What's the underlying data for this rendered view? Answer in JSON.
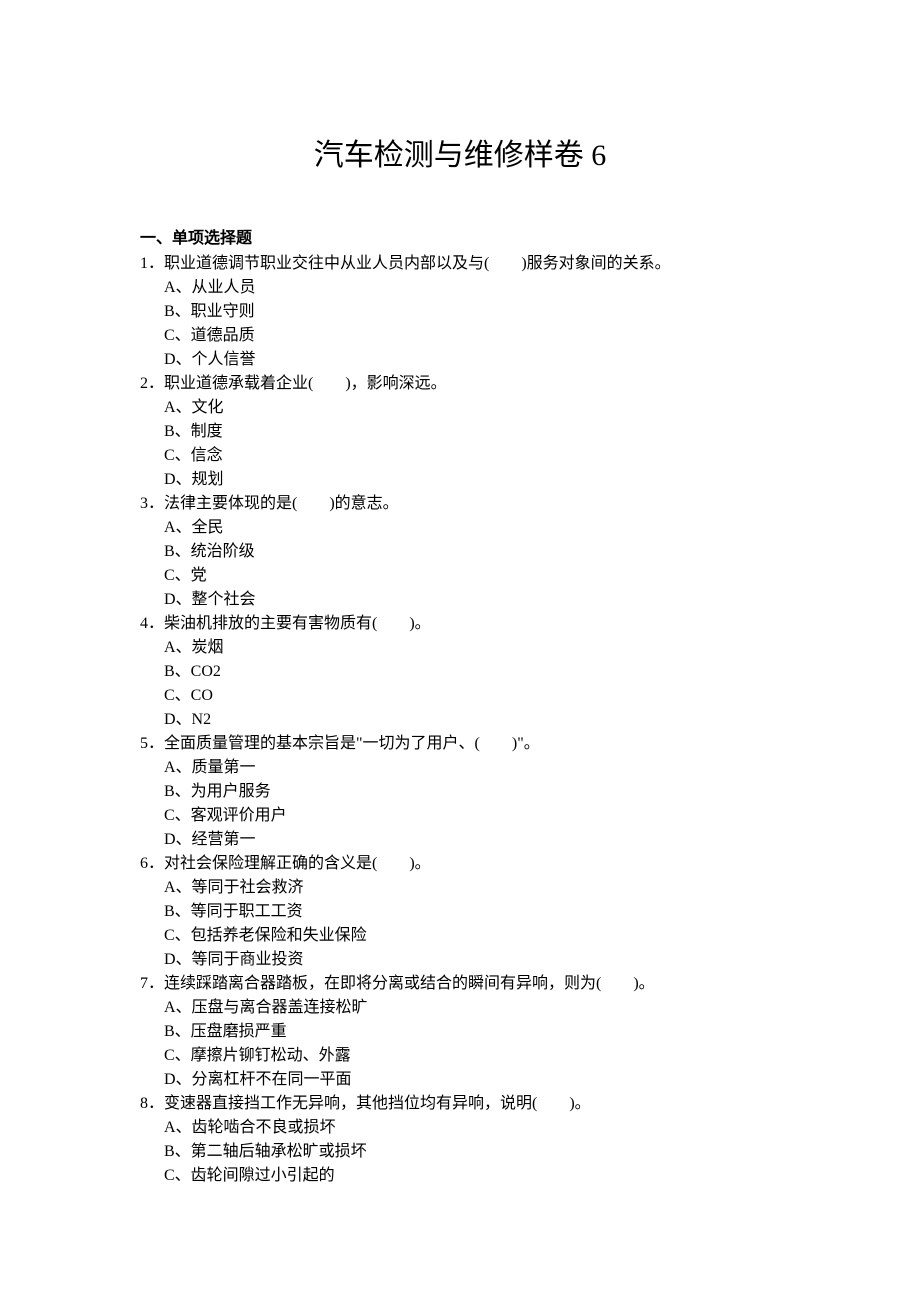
{
  "title": "汽车检测与维修样卷 6",
  "section_heading": "一、单项选择题",
  "questions": [
    {
      "num": "1．",
      "text": "职业道德调节职业交往中从业人员内部以及与(　　)服务对象间的关系。",
      "options": [
        "A、从业人员",
        "B、职业守则",
        "C、道德品质",
        "D、个人信誉"
      ]
    },
    {
      "num": "2．",
      "text": "职业道德承载着企业(　　)，影响深远。",
      "options": [
        "A、文化",
        "B、制度",
        "C、信念",
        "D、规划"
      ]
    },
    {
      "num": "3．",
      "text": "法律主要体现的是(　　)的意志。",
      "options": [
        "A、全民",
        "B、统治阶级",
        "C、党",
        "D、整个社会"
      ]
    },
    {
      "num": "4．",
      "text": "柴油机排放的主要有害物质有(　　)。",
      "options": [
        "A、炭烟",
        "B、CO2",
        "C、CO",
        "D、N2"
      ]
    },
    {
      "num": "5．",
      "text": "全面质量管理的基本宗旨是\"一切为了用户、(　　)\"。",
      "options": [
        "A、质量第一",
        "B、为用户服务",
        "C、客观评价用户",
        "D、经营第一"
      ]
    },
    {
      "num": "6．",
      "text": "对社会保险理解正确的含义是(　　)。",
      "options": [
        "A、等同于社会救济",
        "B、等同于职工工资",
        "C、包括养老保险和失业保险",
        "D、等同于商业投资"
      ]
    },
    {
      "num": "7．",
      "text": "连续踩踏离合器踏板，在即将分离或结合的瞬间有异响，则为(　　)。",
      "options": [
        "A、压盘与离合器盖连接松旷",
        "B、压盘磨损严重",
        "C、摩擦片铆钉松动、外露",
        "D、分离杠杆不在同一平面"
      ]
    },
    {
      "num": "8．",
      "text": "变速器直接挡工作无异响，其他挡位均有异响，说明(　　)。",
      "options": [
        "A、齿轮啮合不良或损坏",
        "B、第二轴后轴承松旷或损坏",
        "C、齿轮间隙过小引起的"
      ]
    }
  ]
}
